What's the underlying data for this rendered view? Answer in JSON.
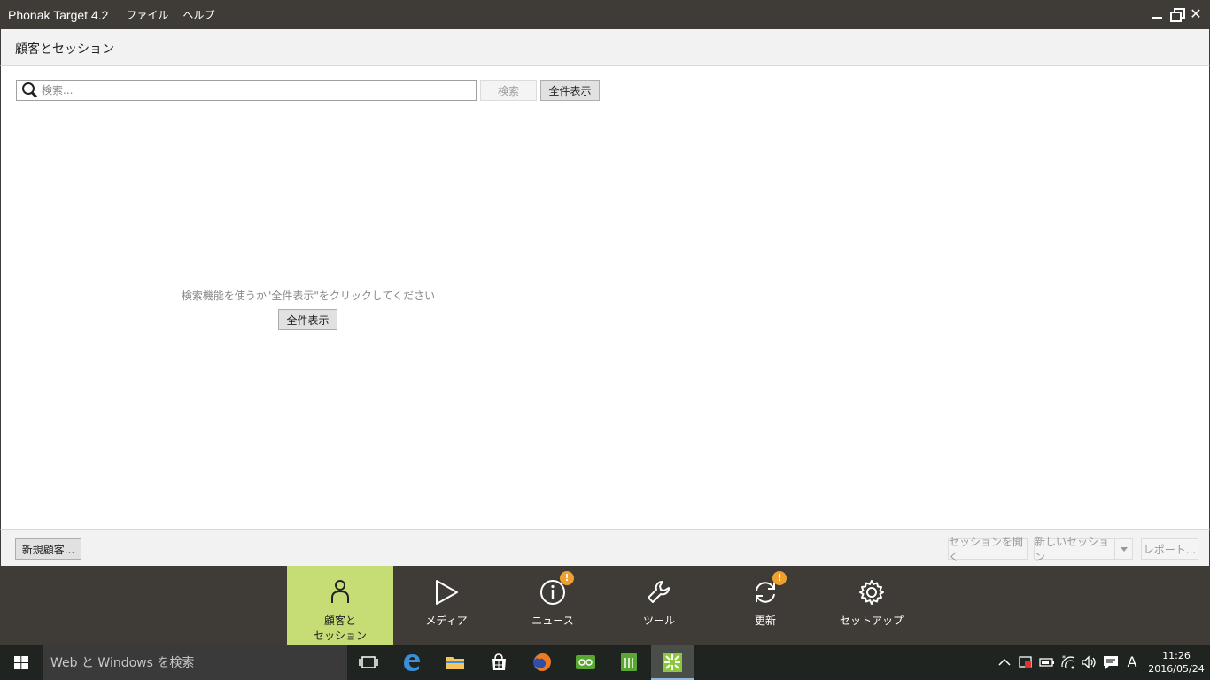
{
  "window": {
    "title": "Phonak Target 4.2",
    "menu": [
      {
        "label": "ファイル"
      },
      {
        "label": "ヘルプ"
      }
    ]
  },
  "section": {
    "title": "顧客とセッション"
  },
  "search": {
    "placeholder": "検索...",
    "value": "",
    "search_label": "検索",
    "show_all_label": "全件表示"
  },
  "empty_state": {
    "hint": "検索機能を使うか\"全件表示\"をクリックしてください",
    "show_all_label": "全件表示"
  },
  "actions": {
    "new_client_label": "新規顧客...",
    "open_session_label": "セッションを開く",
    "new_session_label": "新しいセッション",
    "report_label": "レポート..."
  },
  "nav": {
    "items": [
      {
        "label": "顧客と\nセッション",
        "icon": "person-icon",
        "active": true,
        "badge": ""
      },
      {
        "label": "メディア",
        "icon": "play-icon",
        "active": false,
        "badge": ""
      },
      {
        "label": "ニュース",
        "icon": "info-icon",
        "active": false,
        "badge": "!"
      },
      {
        "label": "ツール",
        "icon": "wrench-icon",
        "active": false,
        "badge": ""
      },
      {
        "label": "更新",
        "icon": "refresh-icon",
        "active": false,
        "badge": "!"
      },
      {
        "label": "セットアップ",
        "icon": "gear-icon",
        "active": false,
        "badge": ""
      }
    ]
  },
  "taskbar": {
    "search_placeholder": "Web と Windows を検索",
    "apps": [
      {
        "name": "task-view-icon"
      },
      {
        "name": "edge-icon"
      },
      {
        "name": "file-explorer-icon"
      },
      {
        "name": "store-icon"
      },
      {
        "name": "firefox-icon"
      },
      {
        "name": "noahlink-icon"
      },
      {
        "name": "notes-app-icon"
      },
      {
        "name": "phonak-target-icon"
      }
    ],
    "ime": "A",
    "time": "11:26",
    "date": "2016/05/24"
  },
  "colors": {
    "titlebar": "#3f3c37",
    "active_nav": "#c6dc74",
    "badge": "#f0a030"
  }
}
